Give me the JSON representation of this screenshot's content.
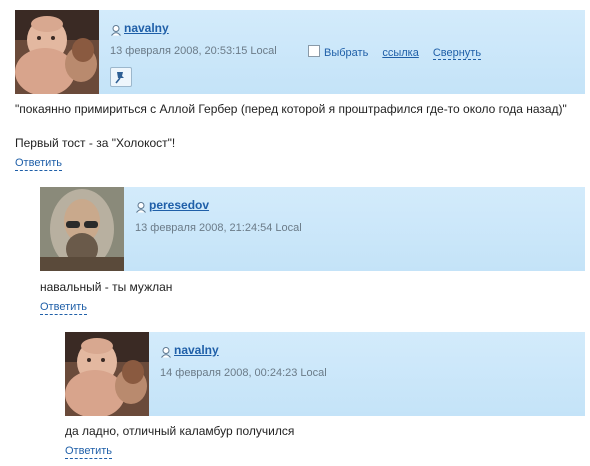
{
  "comments": [
    {
      "username": "navalny",
      "date": "13 февраля 2008, 20:53:15 Local",
      "select_label": "Выбрать",
      "link_label": "ссылка",
      "collapse_label": "Свернуть",
      "body": [
        "\"покаянно примириться с Аллой Гербер (перед которой я проштрафился где-то около года назад)\"",
        "Первый тост - за \"Холокост\"!"
      ],
      "reply_label": "Ответить"
    },
    {
      "username": "peresedov",
      "date": "13 февраля 2008, 21:24:54 Local",
      "body": [
        "навальный - ты мужлан"
      ],
      "reply_label": "Ответить"
    },
    {
      "username": "navalny",
      "date": "14 февраля 2008, 00:24:23 Local",
      "body": [
        "да ладно, отличный каламбур получился"
      ],
      "reply_label": "Ответить"
    }
  ],
  "colors": {
    "header_bg": "#cde7f9",
    "link": "#1f5fa8",
    "date": "#6b7b88"
  }
}
